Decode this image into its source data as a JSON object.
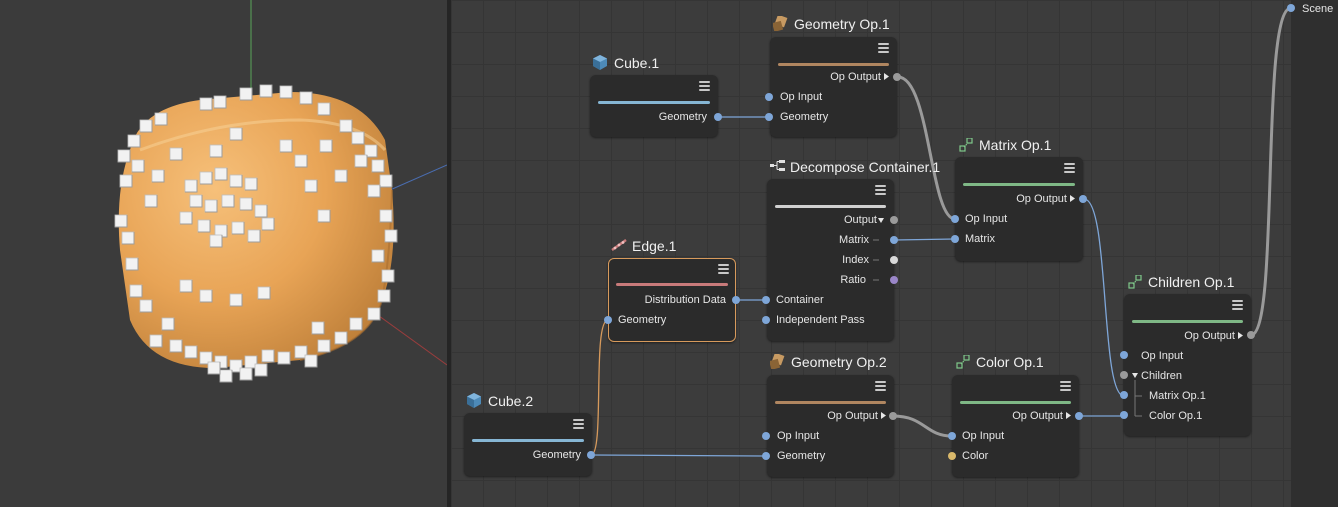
{
  "colors": {
    "port_blue": "#7ea6d8",
    "port_gray": "#9a9a9a",
    "port_yellow": "#d9b86a",
    "port_purple": "#9a86c8",
    "bar_blue": "#86b6d4",
    "bar_brown": "#b08660",
    "bar_white": "#d0d0d0",
    "bar_red": "#c87a7a",
    "bar_green": "#7fb886",
    "selection": "#d79a5c"
  },
  "scene": {
    "label": "Scene"
  },
  "nodes": {
    "cube1": {
      "title": "Cube.1",
      "icon": "cube-icon",
      "geometry": "Geometry"
    },
    "cube2": {
      "title": "Cube.2",
      "icon": "cube-icon",
      "geometry": "Geometry"
    },
    "geomop1": {
      "title": "Geometry Op.1",
      "icon": "geometry-op-icon",
      "op_output": "Op Output",
      "op_input": "Op Input",
      "geometry": "Geometry"
    },
    "geomop2": {
      "title": "Geometry Op.2",
      "icon": "geometry-op-icon",
      "op_output": "Op Output",
      "op_input": "Op Input",
      "geometry": "Geometry"
    },
    "decompose": {
      "title": "Decompose Container.1",
      "icon": "decompose-icon",
      "output": "Output",
      "matrix": "Matrix",
      "index": "Index",
      "ratio": "Ratio",
      "container": "Container",
      "independent_pass": "Independent Pass"
    },
    "edge": {
      "title": "Edge.1",
      "icon": "edge-icon",
      "distribution_data": "Distribution Data",
      "geometry": "Geometry"
    },
    "matrixop": {
      "title": "Matrix Op.1",
      "icon": "matrix-op-icon",
      "op_output": "Op Output",
      "op_input": "Op Input",
      "matrix": "Matrix"
    },
    "colorop": {
      "title": "Color Op.1",
      "icon": "color-op-icon",
      "op_output": "Op Output",
      "op_input": "Op Input",
      "color": "Color"
    },
    "childrenop": {
      "title": "Children Op.1",
      "icon": "children-op-icon",
      "op_output": "Op Output",
      "op_input": "Op Input",
      "children": "Children",
      "matrix_op": "Matrix Op.1",
      "color_op": "Color Op.1"
    }
  }
}
